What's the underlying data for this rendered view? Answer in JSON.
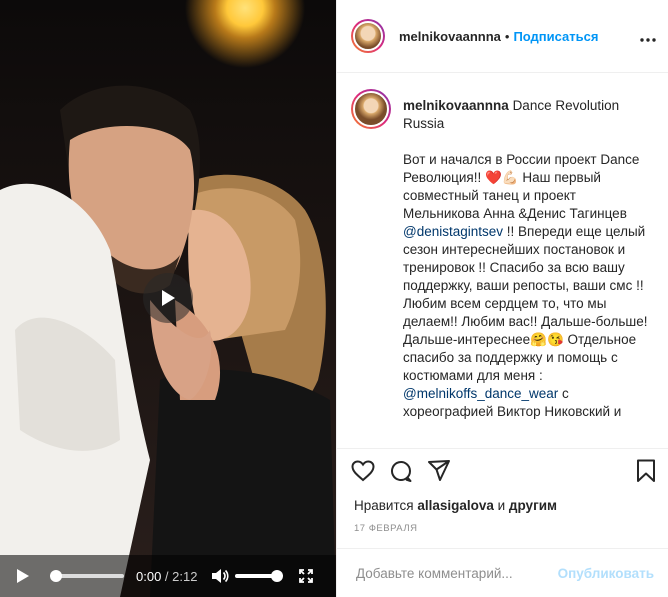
{
  "video": {
    "current_time": "0:00",
    "separator": " / ",
    "duration": "2:12",
    "icons": [
      "play-icon",
      "volume-icon",
      "fullscreen-icon"
    ]
  },
  "header": {
    "username": "melnikovaannna",
    "dot": "•",
    "follow_label": "Подписаться",
    "more_icon": "more-options-icon"
  },
  "caption": {
    "username": "melnikovaannna",
    "location": "Dance Revolution Russia",
    "text_part1": "Вот и начался в России проект Dance Революция!! ❤️💪🏻 Наш первый совместный танец и проект Мельникова Анна &Денис Тагинцев ",
    "mention1": "@denistagintsev",
    "text_part2": " !! Впереди еще целый сезон интереснейших постановок и тренировок !! Спасибо за всю вашу поддержку, ваши репосты, ваши смс !! Любим всем сердцем то, что мы делаем!! Любим вас!! Дальше-больше! Дальше-интереснее🤗😘 Отдельное спасибо за поддержку и помощь с костюмами для меня : ",
    "mention2": "@melnikoffs_dance_wear",
    "text_part3": " с хореографией Виктор Никовский и"
  },
  "actions": {
    "icons": [
      "heart-icon",
      "comment-icon",
      "share-icon",
      "bookmark-icon"
    ],
    "likes_prefix": "Нравится ",
    "likes_user": "allasigalova",
    "likes_middle": " и ",
    "likes_others": "другим",
    "date": "17 ФЕВРАЛЯ"
  },
  "comment": {
    "placeholder": "Добавьте комментарий...",
    "post_label": "Опубликовать"
  },
  "colors": {
    "accent": "#0095f6",
    "link": "#00376b",
    "post_disabled": "#b2dffc"
  }
}
